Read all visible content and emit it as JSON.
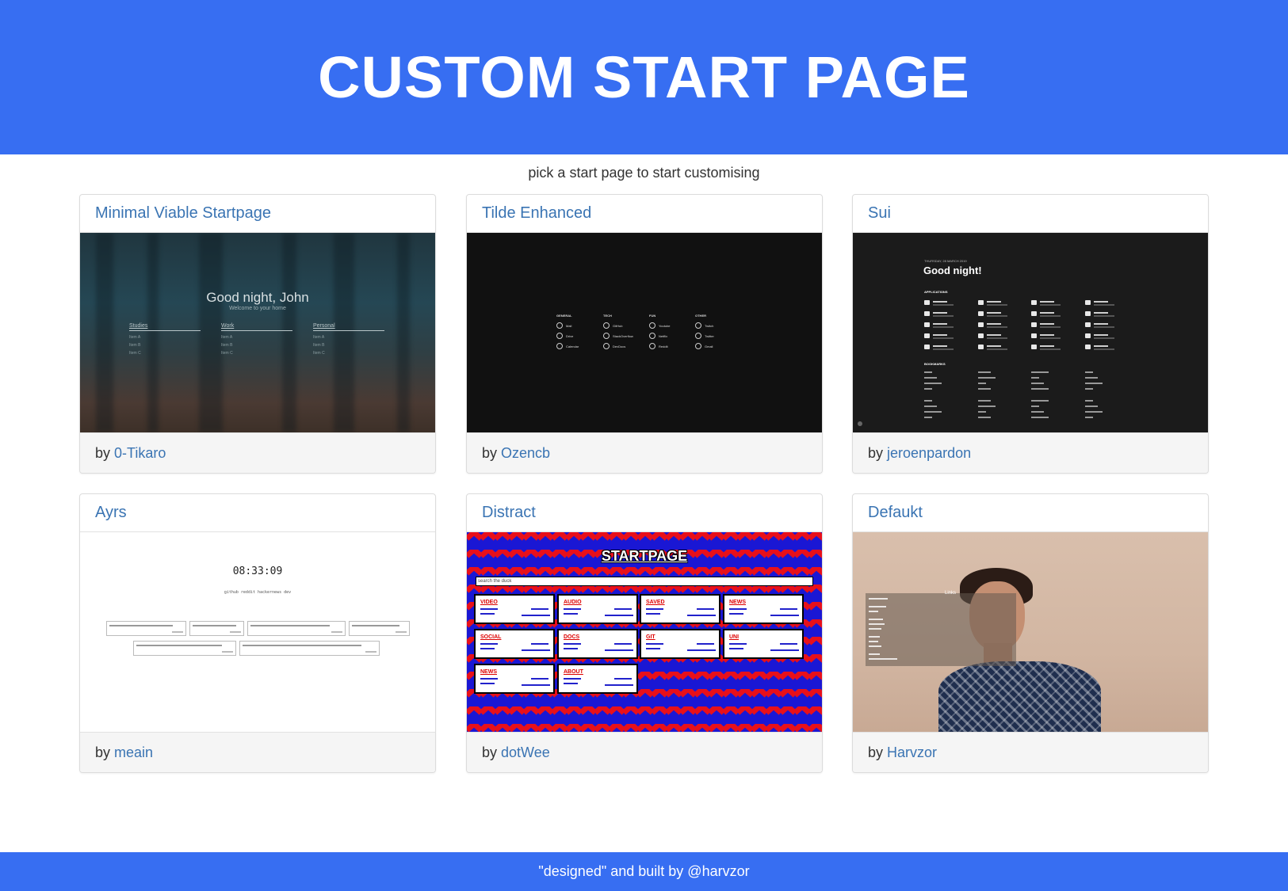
{
  "header": {
    "title": "CUSTOM START PAGE"
  },
  "subtitle": "pick a start page to start customising",
  "cards": [
    {
      "title": "Minimal Viable Startpage",
      "by": "by",
      "author": "0-Tikaro"
    },
    {
      "title": "Tilde Enhanced",
      "by": "by",
      "author": "Ozencb"
    },
    {
      "title": "Sui",
      "by": "by",
      "author": "jeroenpardon"
    },
    {
      "title": "Ayrs",
      "by": "by",
      "author": "meain"
    },
    {
      "title": "Distract",
      "by": "by",
      "author": "dotWee"
    },
    {
      "title": "Defaukt",
      "by": "by",
      "author": "Harvzor"
    }
  ],
  "previews": {
    "minimal": {
      "greeting": "Good night, John",
      "sub": "Welcome to your home",
      "columns": [
        {
          "heading": "Studies",
          "items": [
            "Item A",
            "Item B",
            "Item C"
          ]
        },
        {
          "heading": "Work",
          "items": [
            "Item A",
            "Item B",
            "Item C"
          ]
        },
        {
          "heading": "Personal",
          "items": [
            "Item A",
            "Item B",
            "Item C"
          ]
        }
      ]
    },
    "tilde": {
      "columns": [
        {
          "heading": "GENERAL",
          "items": [
            "Mail",
            "Drive",
            "Calendar"
          ]
        },
        {
          "heading": "TECH",
          "items": [
            "GitHub",
            "StackOverflow",
            "DevDocs"
          ]
        },
        {
          "heading": "FUN",
          "items": [
            "Youtube",
            "Netflix",
            "Reddit"
          ]
        },
        {
          "heading": "OTHER",
          "items": [
            "Twitch",
            "Twitter",
            "Gmail"
          ]
        }
      ]
    },
    "sui": {
      "kicker": "THURSDAY, 28 MARCH 2019",
      "greeting": "Good night!",
      "applications_label": "APPLICATIONS",
      "bookmarks_label": "BOOKMARKS"
    },
    "ayrs": {
      "time": "08:33:09",
      "links": "github  reddit  hackernews  dev"
    },
    "distract": {
      "title": "STARTPAGE",
      "search_placeholder": "search the duck",
      "tiles": [
        "VIDEO",
        "AUDIO",
        "SAVED",
        "NEWS",
        "SOCIAL",
        "DOCS",
        "GIT",
        "UNI",
        "NEWS",
        "ABOUT"
      ]
    },
    "defaukt": {
      "panel_title": "Links"
    }
  },
  "footer": {
    "text": "\"designed\" and built by @harvzor"
  },
  "colors": {
    "brand": "#376ef2",
    "link": "#3a74b3"
  }
}
